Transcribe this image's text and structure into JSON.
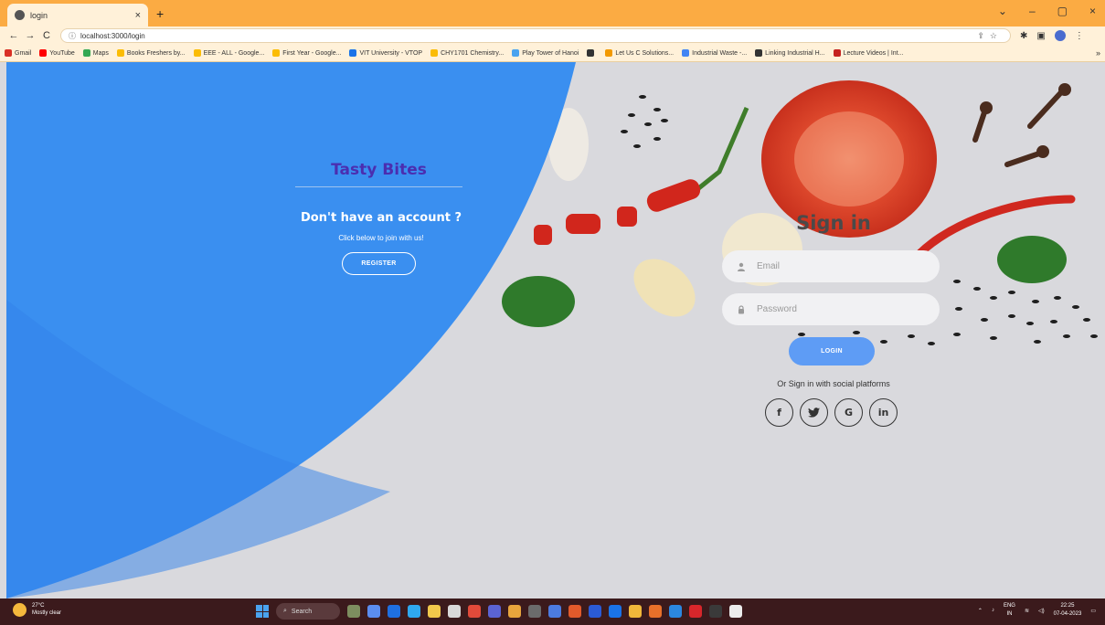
{
  "browser": {
    "tab_title": "login",
    "tab_close": "×",
    "new_tab": "+",
    "window_controls": [
      "⌄",
      "–",
      "▢",
      "×"
    ],
    "nav": {
      "back": "←",
      "forward": "→",
      "reload": "C"
    },
    "url": "localhost:3000/login",
    "bookmarks": [
      {
        "label": "Gmail",
        "color": "#d93025"
      },
      {
        "label": "YouTube",
        "color": "#ff0000"
      },
      {
        "label": "Maps",
        "color": "#34a853"
      },
      {
        "label": "Books Freshers by...",
        "color": "#fbbc04"
      },
      {
        "label": "EEE - ALL - Google...",
        "color": "#fbbc04"
      },
      {
        "label": "First Year - Google...",
        "color": "#fbbc04"
      },
      {
        "label": "VIT University - VTOP",
        "color": "#1a73e8"
      },
      {
        "label": "CHY1701 Chemistry...",
        "color": "#fbbc04"
      },
      {
        "label": "Play Tower of Hanoi",
        "color": "#4aa3ef"
      },
      {
        "label": "",
        "color": "#333333"
      },
      {
        "label": "Let Us C Solutions...",
        "color": "#f29900"
      },
      {
        "label": "Industrial Waste -...",
        "color": "#4285f4"
      },
      {
        "label": "Linking Industrial H...",
        "color": "#333333"
      },
      {
        "label": "Lecture Videos | Int...",
        "color": "#c5221f"
      }
    ],
    "bookmarks_more": "»"
  },
  "left_panel": {
    "brand": "Tasty Bites",
    "cta_title": "Don't have an account ?",
    "cta_subtitle": "Click below to join with us!",
    "register_label": "REGISTER"
  },
  "signin": {
    "title": "Sign in",
    "email_placeholder": "Email",
    "password_placeholder": "Password",
    "login_label": "LOGIN",
    "social_text": "Or Sign in with social platforms",
    "social": [
      {
        "name": "facebook",
        "glyph": "f"
      },
      {
        "name": "twitter",
        "glyph": "🐦"
      },
      {
        "name": "google",
        "glyph": "G"
      },
      {
        "name": "linkedin",
        "glyph": "in"
      }
    ]
  },
  "taskbar": {
    "weather_temp": "27°C",
    "weather_desc": "Mostly clear",
    "search": "Search",
    "lang_top": "ENG",
    "lang_bottom": "IN",
    "time": "22:25",
    "date": "07-04-2023"
  },
  "colors": {
    "accent_blue": "#3a8ff0",
    "brand_purple": "#4b2eb0",
    "login_button": "#5e9cf5",
    "browser_frame": "#fbab43"
  }
}
